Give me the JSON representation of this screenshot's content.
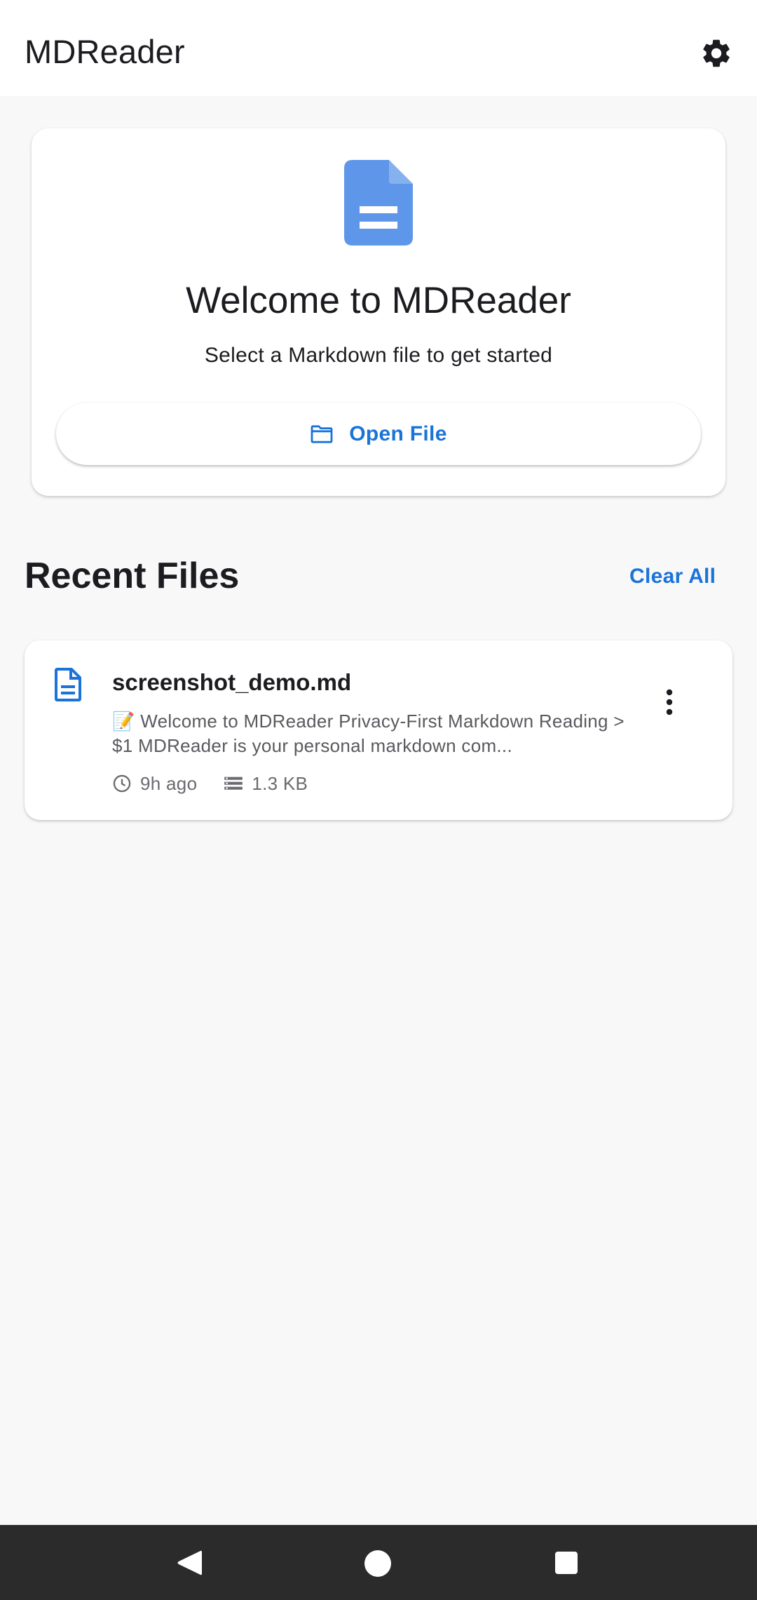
{
  "app": {
    "title": "MDReader",
    "accent_color": "#1a73d9",
    "settings_icon": "gear-icon"
  },
  "welcome": {
    "icon": "document-icon",
    "title": "Welcome to MDReader",
    "subtitle": "Select a Markdown file to get started",
    "open_button": {
      "icon": "folder-icon",
      "label": "Open File"
    }
  },
  "recent": {
    "title": "Recent Files",
    "clear_label": "Clear All",
    "files": [
      {
        "icon": "document-icon",
        "name": "screenshot_demo.md",
        "preview": "📝 Welcome to MDReader Privacy-First Markdown Reading > $1 MDReader is your personal markdown com...",
        "time": "9h ago",
        "time_icon": "clock-icon",
        "size": "1.3 KB",
        "size_icon": "storage-icon",
        "menu_icon": "more-vert-icon"
      }
    ]
  },
  "navbar": {
    "back_icon": "back-triangle-icon",
    "home_icon": "home-circle-icon",
    "recents_icon": "recents-square-icon"
  }
}
